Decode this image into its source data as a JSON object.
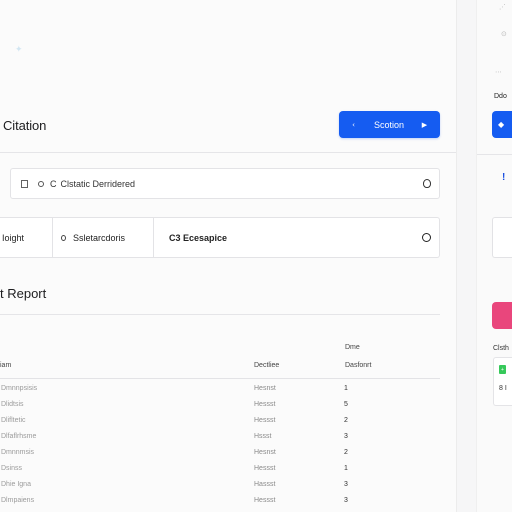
{
  "page": {
    "ghost_glyph": "✦",
    "title": "Citation",
    "primary_button": {
      "left_icon": "‹",
      "label": "Scotion",
      "right_icon": "▶"
    },
    "search_field": {
      "prefix_letter": "C",
      "value": "Clstatic Derridered"
    },
    "segments": [
      {
        "label": "Ioight"
      },
      {
        "label": "Ssletarcdoris"
      },
      {
        "label": "C3 Ecesapice"
      }
    ],
    "report_title": "t Report",
    "table": {
      "top_header": "Dme",
      "headers": [
        "iam",
        "Dectliee",
        "Dasfonrt"
      ],
      "rows": [
        {
          "name": "Dmnnpsisis",
          "type": "Hesnst",
          "value": "1"
        },
        {
          "name": "Dlidtsis",
          "type": "Hessst",
          "value": "5"
        },
        {
          "name": "Dlifltetic",
          "type": "Hessst",
          "value": "2"
        },
        {
          "name": "Dlfaflrhsme",
          "type": "Hssst",
          "value": "3"
        },
        {
          "name": "Dmnnmsis",
          "type": "Hesnst",
          "value": "2"
        },
        {
          "name": "Dsinss",
          "type": "Hessst",
          "value": "1"
        },
        {
          "name": "Dhie Igna",
          "type": "Hassst",
          "value": "3"
        },
        {
          "name": "Dlmpaiens",
          "type": "Hessst",
          "value": "3"
        }
      ]
    }
  },
  "right_panel": {
    "glyphs": [
      "⋰",
      "⊙",
      "⋯"
    ],
    "label": "Ddo",
    "button_icon": "◆",
    "alert": "!",
    "small_label": "Clsth",
    "green_badge": "+",
    "card_text": "8 I"
  }
}
